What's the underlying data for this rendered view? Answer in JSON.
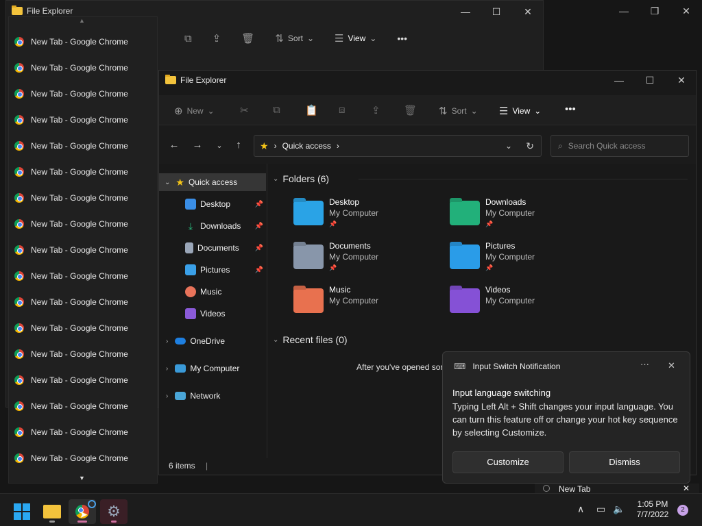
{
  "back_explorer": {
    "title": "File Explorer",
    "toolbar": {
      "sort": "Sort",
      "view": "View",
      "more": "•••"
    }
  },
  "background_window": {
    "controls": [
      "—",
      "❐",
      "✕"
    ]
  },
  "explorer": {
    "title": "File Explorer",
    "controls": [
      "—",
      "☐",
      "✕"
    ],
    "toolbar": {
      "new": "New",
      "sort": "Sort",
      "view": "View",
      "more": "•••"
    },
    "address": {
      "location": "Quick access"
    },
    "search": {
      "placeholder": "Search Quick access"
    },
    "sidebar": {
      "quick_access": "Quick access",
      "items": [
        {
          "label": "Desktop",
          "icon": "desktop-icon",
          "color": "#3a8ee6",
          "pinned": true
        },
        {
          "label": "Downloads",
          "icon": "downloads-icon",
          "color": "#28b57a",
          "pinned": true
        },
        {
          "label": "Documents",
          "icon": "documents-icon",
          "color": "#9aa6b8",
          "pinned": true
        },
        {
          "label": "Pictures",
          "icon": "pictures-icon",
          "color": "#3aa0e8",
          "pinned": true
        },
        {
          "label": "Music",
          "icon": "music-icon",
          "color": "#e8735a",
          "pinned": false
        },
        {
          "label": "Videos",
          "icon": "videos-icon",
          "color": "#8a5ad8",
          "pinned": false
        }
      ],
      "onedrive": "OneDrive",
      "my_computer": "My Computer",
      "network": "Network"
    },
    "folders_heading": "Folders (6)",
    "folders": [
      {
        "name": "Desktop",
        "location": "My Computer",
        "color": "#2aa3e6",
        "pinned": true
      },
      {
        "name": "Downloads",
        "location": "My Computer",
        "color": "#22b07a",
        "pinned": true
      },
      {
        "name": "Documents",
        "location": "My Computer",
        "color": "#8896aa",
        "pinned": true
      },
      {
        "name": "Pictures",
        "location": "My Computer",
        "color": "#2a9ce8",
        "pinned": true
      },
      {
        "name": "Music",
        "location": "My Computer",
        "color": "#e8714f",
        "pinned": false
      },
      {
        "name": "Videos",
        "location": "My Computer",
        "color": "#8551d6",
        "pinned": false
      }
    ],
    "recent_heading": "Recent files (0)",
    "recent_empty": "After you've opened sor",
    "status": "6 items"
  },
  "chrome_list": {
    "items": [
      "New Tab - Google Chrome",
      "New Tab - Google Chrome",
      "New Tab - Google Chrome",
      "New Tab - Google Chrome",
      "New Tab - Google Chrome",
      "New Tab - Google Chrome",
      "New Tab - Google Chrome",
      "New Tab - Google Chrome",
      "New Tab - Google Chrome",
      "New Tab - Google Chrome",
      "New Tab - Google Chrome",
      "New Tab - Google Chrome",
      "New Tab - Google Chrome",
      "New Tab - Google Chrome",
      "New Tab - Google Chrome",
      "New Tab - Google Chrome",
      "New Tab - Google Chrome"
    ]
  },
  "notification": {
    "app": "Input Switch Notification",
    "title": "Input language switching",
    "body": "Typing Left Alt + Shift changes your input language. You can turn this feature off or change your hot key sequence by selecting Customize.",
    "customize": "Customize",
    "dismiss": "Dismiss"
  },
  "chrome_tab_peek": {
    "label": "New Tab"
  },
  "taskbar": {
    "time": "1:05 PM",
    "date": "7/7/2022",
    "notification_count": "2"
  }
}
